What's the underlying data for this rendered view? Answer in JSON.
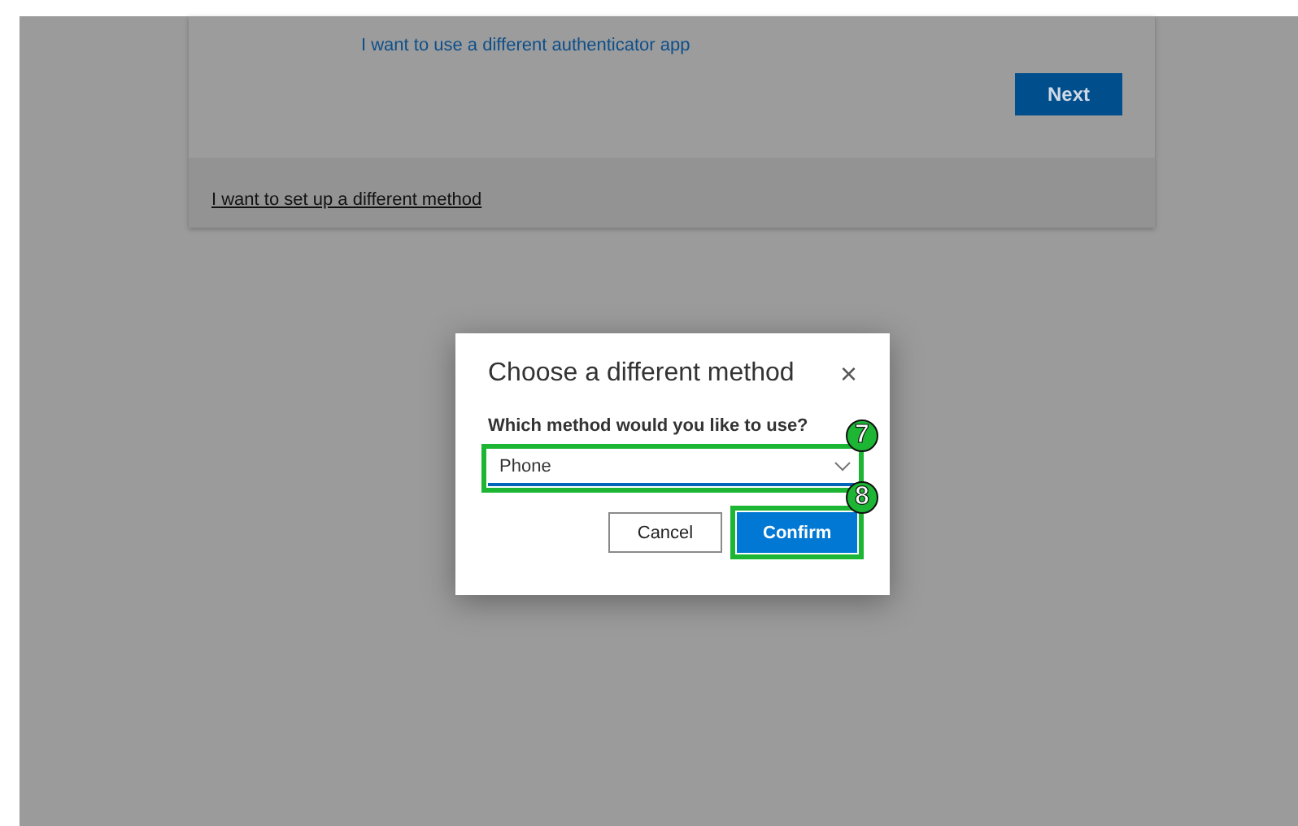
{
  "background_card": {
    "link": "I want to use a different authenticator app",
    "next_button": "Next",
    "footer_link": "I want to set up a different method"
  },
  "dialog": {
    "title": "Choose a different method",
    "close": "×",
    "question": "Which method would you like to use?",
    "select": {
      "value": "Phone",
      "annotation": "7"
    },
    "buttons": [
      {
        "label": "Cancel",
        "kind": "secondary"
      },
      {
        "label": "Confirm",
        "kind": "primary",
        "annotation": "8"
      }
    ]
  }
}
